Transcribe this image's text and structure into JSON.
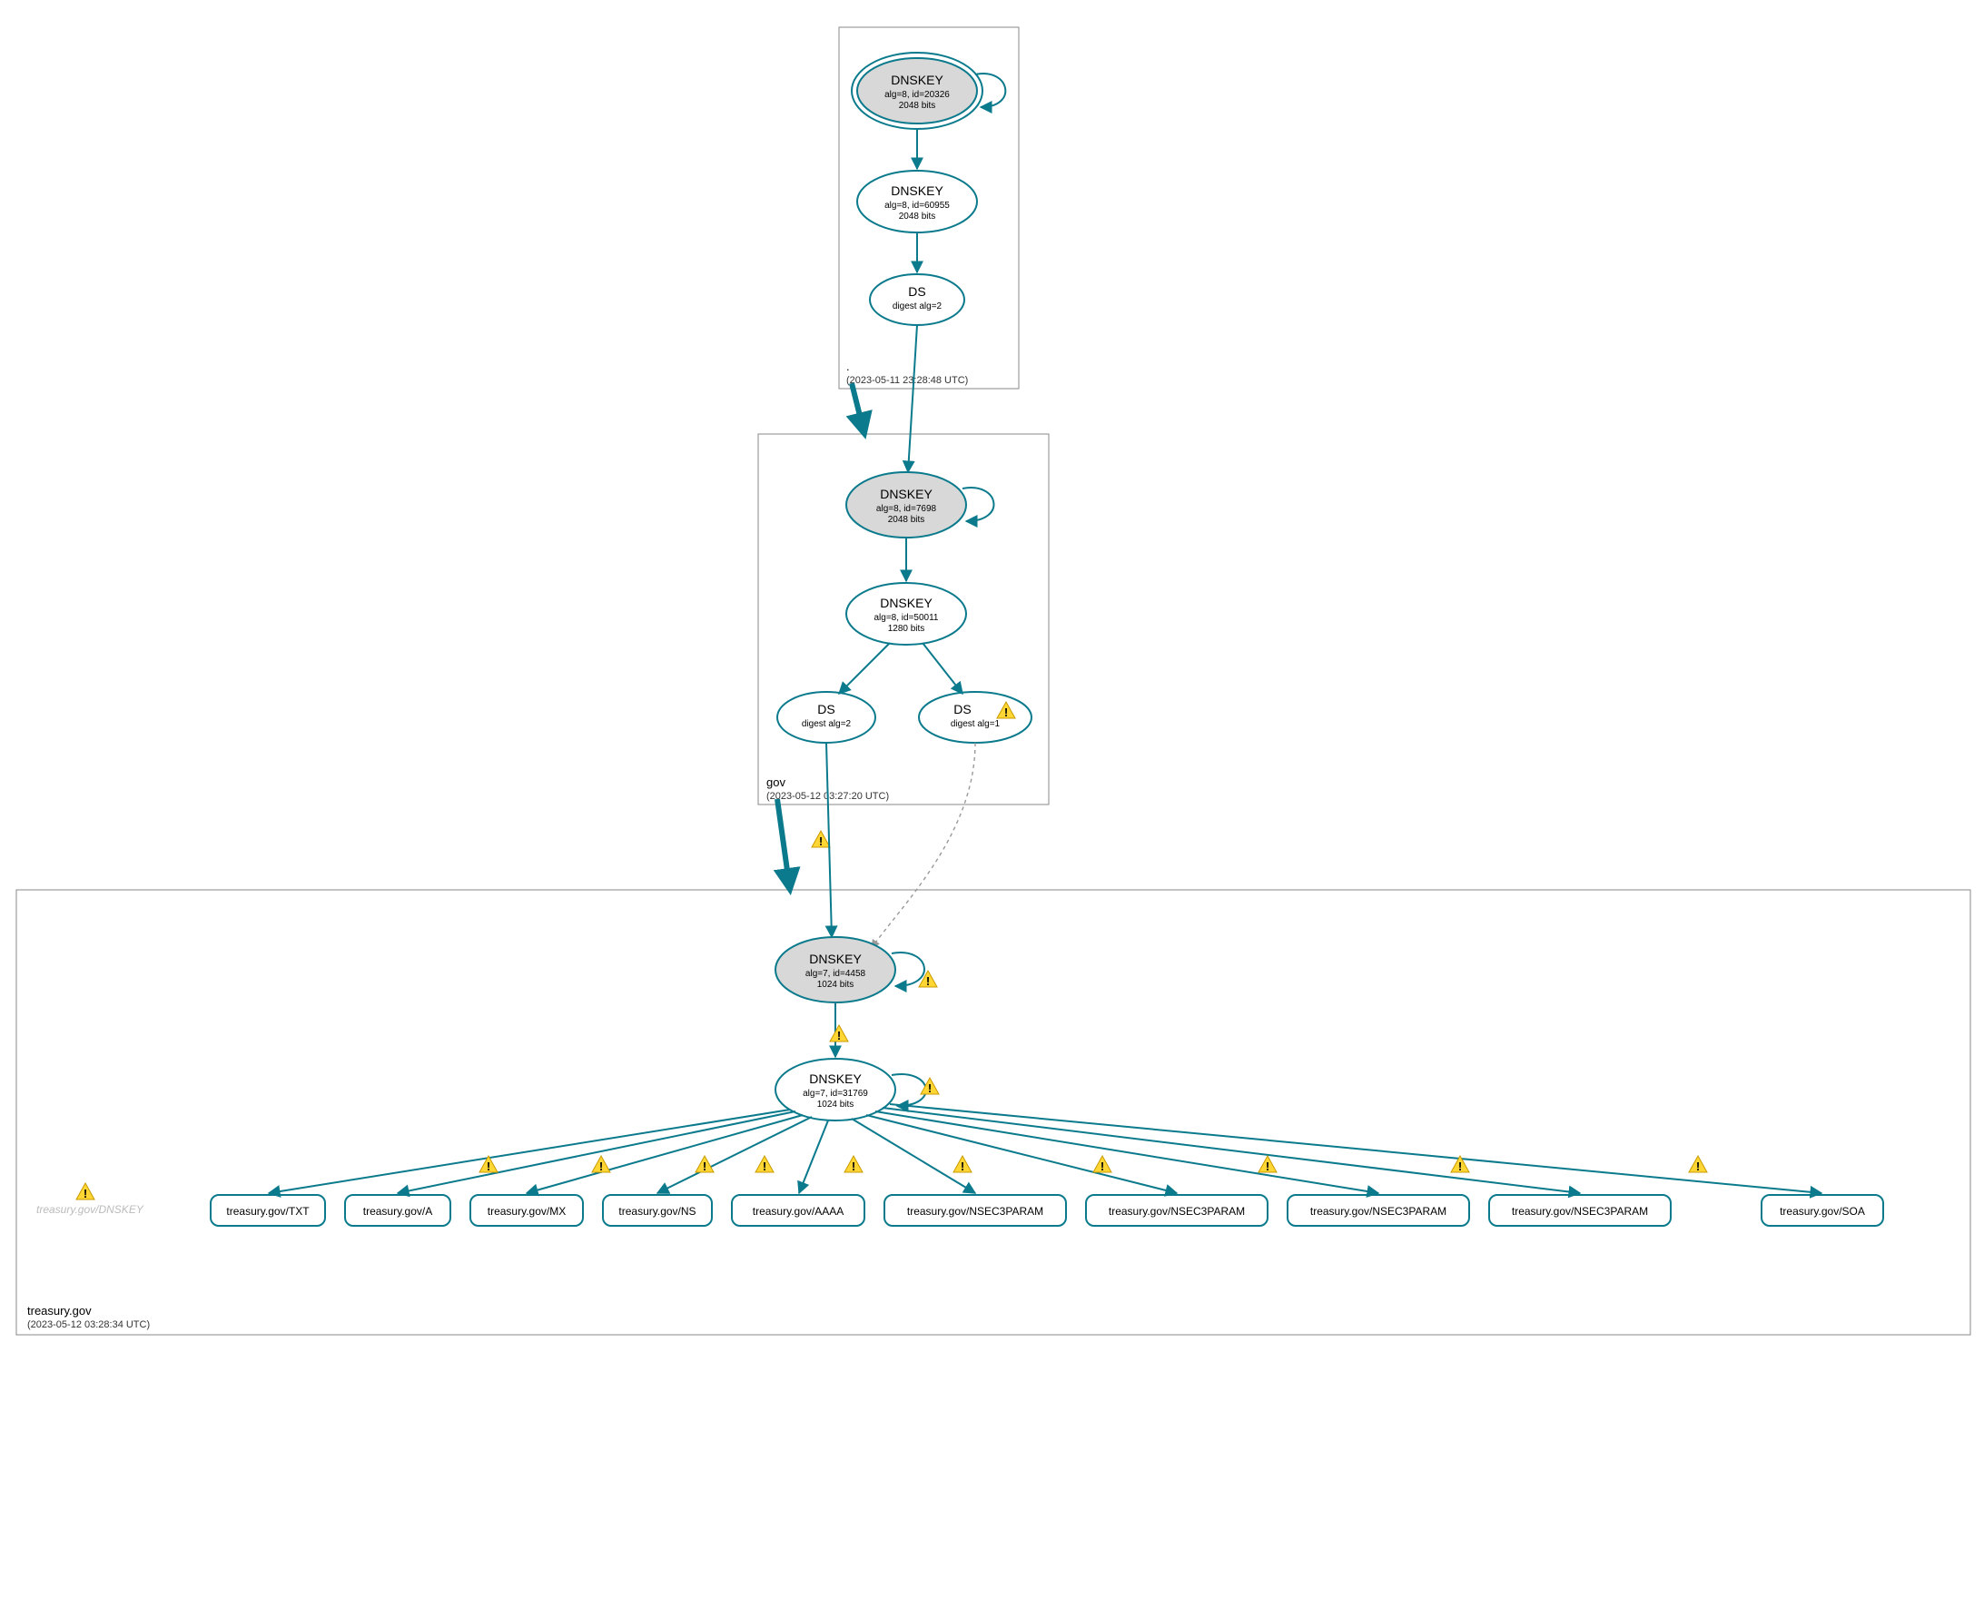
{
  "zones": {
    "root": {
      "label": ".",
      "timestamp": "(2023-05-11 23:28:48 UTC)"
    },
    "gov": {
      "label": "gov",
      "timestamp": "(2023-05-12 03:27:20 UTC)"
    },
    "treasury": {
      "label": "treasury.gov",
      "timestamp": "(2023-05-12 03:28:34 UTC)"
    }
  },
  "nodes": {
    "root_ksk": {
      "title": "DNSKEY",
      "l2": "alg=8, id=20326",
      "l3": "2048 bits"
    },
    "root_zsk": {
      "title": "DNSKEY",
      "l2": "alg=8, id=60955",
      "l3": "2048 bits"
    },
    "root_ds": {
      "title": "DS",
      "l2": "digest alg=2",
      "l3": ""
    },
    "gov_ksk": {
      "title": "DNSKEY",
      "l2": "alg=8, id=7698",
      "l3": "2048 bits"
    },
    "gov_zsk": {
      "title": "DNSKEY",
      "l2": "alg=8, id=50011",
      "l3": "1280 bits"
    },
    "gov_ds1": {
      "title": "DS",
      "l2": "digest alg=2",
      "l3": ""
    },
    "gov_ds2": {
      "title": "DS",
      "l2": "digest alg=1",
      "l3": ""
    },
    "tg_ksk": {
      "title": "DNSKEY",
      "l2": "alg=7, id=4458",
      "l3": "1024 bits"
    },
    "tg_zsk": {
      "title": "DNSKEY",
      "l2": "alg=7, id=31769",
      "l3": "1024 bits"
    }
  },
  "rrsets": {
    "r0": "treasury.gov/TXT",
    "r1": "treasury.gov/A",
    "r2": "treasury.gov/MX",
    "r3": "treasury.gov/NS",
    "r4": "treasury.gov/AAAA",
    "r5": "treasury.gov/NSEC3PARAM",
    "r6": "treasury.gov/NSEC3PARAM",
    "r7": "treasury.gov/NSEC3PARAM",
    "r8": "treasury.gov/NSEC3PARAM",
    "r9": "treasury.gov/SOA"
  },
  "grey_label": "treasury.gov/DNSKEY",
  "colors": {
    "teal": "#0a7a8c"
  }
}
